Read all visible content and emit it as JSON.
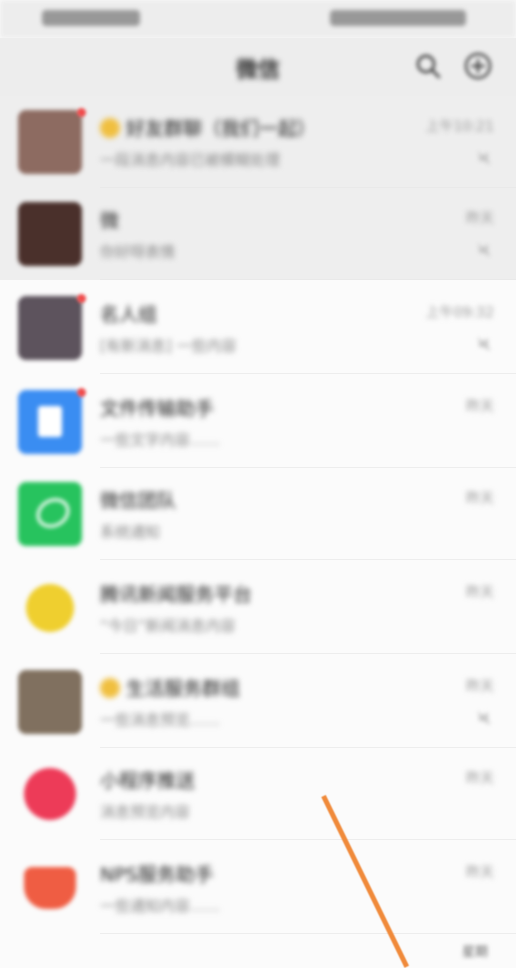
{
  "colors": {
    "background": "#fbfbfb",
    "header_background": "#ededed",
    "pinned_row_background": "#eeeeee",
    "unread_dot": "#f04b4b",
    "orange_pointer": "#f08a3a",
    "wechat_green": "#27c35e",
    "blue_app": "#3a8df2"
  },
  "header": {
    "title": "微信",
    "search_icon": "search-icon",
    "add_icon": "plus-circle-icon"
  },
  "chats": [
    {
      "name": "好友群聊（我们一起）",
      "preview": "一段消息内容已被模糊处理",
      "time": "上午10:21",
      "avatar_color": "#8d6b61",
      "highlight": true,
      "has_dot": true,
      "muted": true
    },
    {
      "name": "微",
      "preview": "你好呀表情",
      "time": "昨天",
      "avatar_color": "#4a302b",
      "highlight": true,
      "has_dot": false,
      "muted": true
    },
    {
      "name": "名人组",
      "preview": "[有新消息] 一些内容",
      "time": "上午09:32",
      "avatar_color": "#5d535d",
      "highlight": false,
      "has_dot": true,
      "muted": true
    },
    {
      "name": "文件传输助手",
      "preview": "一些文字内容……",
      "time": "昨天",
      "avatar_color": "#3a8df2",
      "highlight": false,
      "has_dot": true,
      "muted": false
    },
    {
      "name": "微信团队",
      "preview": "系统通知",
      "time": "昨天",
      "avatar_color": "#27c35e",
      "highlight": false,
      "has_dot": false,
      "muted": false
    },
    {
      "name": "腾讯新闻服务平台",
      "preview": "“今日”新闻消息内容",
      "time": "昨天",
      "avatar_color": "#efcf2f",
      "highlight": false,
      "has_dot": false,
      "muted": false
    },
    {
      "name": "生活服务群组",
      "preview": "一些消息预览……",
      "time": "昨天",
      "avatar_color": "#80705f",
      "highlight": false,
      "has_dot": false,
      "muted": true
    },
    {
      "name": "小程序推送",
      "preview": "消息预览内容",
      "time": "昨天",
      "avatar_color": "#ed3b58",
      "highlight": false,
      "has_dot": false,
      "muted": false
    },
    {
      "name": "NPS服务助手",
      "preview": "一些通知内容……",
      "time": "昨天",
      "avatar_color": "#ef5d43",
      "highlight": false,
      "has_dot": false,
      "muted": false
    }
  ],
  "bottom_time": "星期"
}
